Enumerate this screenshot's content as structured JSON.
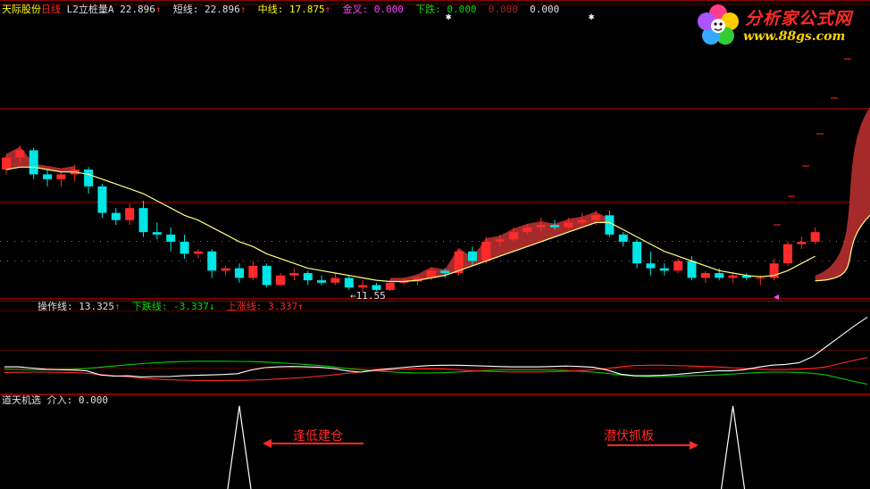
{
  "header": {
    "stock_name": "天际股份",
    "period": "日线",
    "indicator": "L2立桩量A",
    "value1": "22.896",
    "short_label": "短线:",
    "short_value": "22.896",
    "mid_label": "中线:",
    "mid_value": "17.875",
    "gold_label": "金叉:",
    "gold_value": "0.000",
    "down_label": "下跌:",
    "down_value": "0.000",
    "extra1": "0.000",
    "extra2": "0.000",
    "arrow_up": "↑",
    "arrow_down": "↓"
  },
  "low_marker": "11.55",
  "sub1": {
    "op_label": "操作线:",
    "op_value": "13.325",
    "down_label": "下跌线:",
    "down_value": "-3.337",
    "up_label": "上涨线:",
    "up_value": "3.337"
  },
  "sub2": {
    "title": "道天机选",
    "enter_label": "介入:",
    "enter_value": "0.000"
  },
  "logo": {
    "title": "分析家公式网",
    "url": "www.88gs.com"
  },
  "annotations": {
    "left": "逢低建仓",
    "right": "潜伏抓板"
  },
  "colors": {
    "up": "#ff2a2a",
    "down": "#00e5e5",
    "band": "#a52a2a",
    "ma": "#ffff80",
    "grid": "#8b0000",
    "green": "#00cc00",
    "white": "#ffffff"
  },
  "chart_data": {
    "type": "candlestick",
    "candles": [
      [
        16.6,
        17.2,
        16.4,
        17.1
      ],
      [
        17.1,
        17.6,
        16.9,
        17.4
      ],
      [
        17.4,
        17.5,
        16.2,
        16.4
      ],
      [
        16.4,
        16.6,
        15.9,
        16.2
      ],
      [
        16.2,
        16.5,
        15.9,
        16.4
      ],
      [
        16.4,
        16.8,
        16.1,
        16.6
      ],
      [
        16.6,
        16.7,
        15.6,
        15.9
      ],
      [
        15.9,
        16.0,
        14.6,
        14.8
      ],
      [
        14.8,
        15.0,
        14.3,
        14.5
      ],
      [
        14.5,
        15.2,
        14.3,
        15.0
      ],
      [
        15.0,
        15.3,
        13.8,
        14.0
      ],
      [
        14.0,
        14.4,
        13.7,
        13.9
      ],
      [
        13.9,
        14.2,
        13.2,
        13.6
      ],
      [
        13.6,
        13.9,
        12.9,
        13.1
      ],
      [
        13.1,
        13.3,
        12.9,
        13.2
      ],
      [
        13.2,
        13.3,
        12.1,
        12.4
      ],
      [
        12.4,
        12.6,
        12.2,
        12.5
      ],
      [
        12.5,
        12.7,
        11.9,
        12.1
      ],
      [
        12.1,
        12.8,
        12.0,
        12.6
      ],
      [
        12.6,
        12.7,
        11.7,
        11.8
      ],
      [
        11.8,
        12.3,
        11.8,
        12.2
      ],
      [
        12.2,
        12.5,
        12.0,
        12.3
      ],
      [
        12.3,
        12.4,
        11.8,
        12.0
      ],
      [
        12.0,
        12.2,
        11.8,
        11.9
      ],
      [
        11.9,
        12.3,
        11.8,
        12.1
      ],
      [
        12.1,
        12.2,
        11.6,
        11.7
      ],
      [
        11.7,
        12.0,
        11.5,
        11.8
      ],
      [
        11.8,
        11.9,
        11.55,
        11.6
      ],
      [
        11.6,
        12.0,
        11.55,
        11.9
      ],
      [
        11.9,
        12.1,
        11.8,
        11.95
      ],
      [
        11.95,
        12.2,
        11.8,
        12.1
      ],
      [
        12.1,
        12.5,
        12.0,
        12.4
      ],
      [
        12.4,
        12.5,
        12.1,
        12.3
      ],
      [
        12.3,
        13.3,
        12.2,
        13.2
      ],
      [
        13.2,
        13.4,
        12.6,
        12.8
      ],
      [
        12.8,
        13.8,
        12.7,
        13.6
      ],
      [
        13.6,
        13.9,
        13.4,
        13.7
      ],
      [
        13.7,
        14.2,
        13.6,
        14.0
      ],
      [
        14.0,
        14.3,
        13.9,
        14.2
      ],
      [
        14.2,
        14.6,
        14.0,
        14.3
      ],
      [
        14.3,
        14.5,
        14.1,
        14.2
      ],
      [
        14.2,
        14.6,
        14.1,
        14.4
      ],
      [
        14.4,
        14.8,
        14.3,
        14.5
      ],
      [
        14.5,
        14.9,
        14.3,
        14.7
      ],
      [
        14.7,
        14.9,
        13.8,
        13.9
      ],
      [
        13.9,
        14.0,
        13.4,
        13.6
      ],
      [
        13.6,
        13.7,
        12.5,
        12.7
      ],
      [
        12.7,
        13.2,
        12.2,
        12.5
      ],
      [
        12.5,
        12.7,
        12.2,
        12.4
      ],
      [
        12.4,
        12.9,
        12.3,
        12.8
      ],
      [
        12.8,
        13.0,
        12.0,
        12.1
      ],
      [
        12.1,
        12.4,
        11.9,
        12.3
      ],
      [
        12.3,
        12.5,
        12.0,
        12.1
      ],
      [
        12.1,
        12.3,
        11.9,
        12.2
      ],
      [
        12.2,
        12.3,
        12.0,
        12.1
      ],
      [
        12.1,
        12.2,
        11.8,
        12.1
      ],
      [
        12.1,
        12.9,
        12.0,
        12.7
      ],
      [
        12.7,
        13.6,
        12.6,
        13.5
      ],
      [
        13.5,
        13.8,
        13.3,
        13.6
      ],
      [
        13.6,
        14.2,
        13.5,
        14.0
      ]
    ],
    "ma": [
      16.6,
      16.7,
      16.7,
      16.6,
      16.5,
      16.5,
      16.4,
      16.2,
      16.0,
      15.8,
      15.6,
      15.3,
      15.0,
      14.7,
      14.5,
      14.2,
      13.9,
      13.6,
      13.4,
      13.1,
      12.9,
      12.7,
      12.5,
      12.4,
      12.3,
      12.2,
      12.1,
      12.0,
      11.95,
      11.95,
      12.0,
      12.1,
      12.2,
      12.4,
      12.6,
      12.8,
      13.0,
      13.2,
      13.4,
      13.6,
      13.8,
      14.0,
      14.2,
      14.4,
      14.4,
      14.1,
      13.8,
      13.5,
      13.2,
      13.0,
      12.8,
      12.6,
      12.4,
      12.3,
      12.2,
      12.15,
      12.2,
      12.4,
      12.7,
      13.0
    ],
    "band_extension": {
      "start": 12.2,
      "end_upper": 19.2,
      "end_lower": 14.7
    },
    "y_range": [
      11.3,
      22.9
    ],
    "sub1_series": {
      "op_line": [
        1.0,
        1.0,
        0.7,
        0.4,
        0.3,
        0.2,
        0.0,
        -1.0,
        -1.3,
        -1.2,
        -1.5,
        -1.4,
        -1.4,
        -1.2,
        -1.1,
        -1.0,
        -0.9,
        -0.7,
        0.2,
        0.8,
        1.0,
        1.1,
        1.0,
        0.9,
        0.6,
        0.0,
        -0.3,
        0.2,
        0.5,
        0.8,
        1.1,
        1.3,
        1.4,
        1.4,
        1.3,
        1.2,
        1.1,
        1.0,
        1.0,
        1.0,
        1.1,
        1.2,
        1.1,
        0.9,
        0.2,
        -0.8,
        -1.2,
        -1.2,
        -1.1,
        -0.9,
        -0.6,
        -0.3,
        0.0,
        0.0,
        0.3,
        0.9,
        1.4,
        1.6,
        2.0,
        3.5,
        6.0,
        8.5,
        11.0,
        13.3
      ],
      "down_line": [
        0.4,
        0.35,
        0.3,
        0.3,
        0.35,
        0.4,
        0.6,
        0.9,
        1.2,
        1.5,
        1.8,
        2.0,
        2.2,
        2.3,
        2.4,
        2.4,
        2.4,
        2.35,
        2.3,
        2.2,
        2.0,
        1.8,
        1.6,
        1.3,
        1.0,
        0.6,
        0.3,
        0.0,
        -0.2,
        -0.4,
        -0.5,
        -0.5,
        -0.45,
        -0.3,
        -0.1,
        0.1,
        0.2,
        0.25,
        0.25,
        0.25,
        0.2,
        0.1,
        -0.1,
        -0.3,
        -0.6,
        -1.0,
        -1.3,
        -1.4,
        -1.4,
        -1.3,
        -1.2,
        -1.1,
        -1.0,
        -0.8,
        -0.6,
        -0.4,
        -0.3,
        -0.3,
        -0.4,
        -0.6,
        -1.0,
        -1.8,
        -2.6,
        -3.3
      ],
      "up_line": [
        -0.4,
        -0.35,
        -0.3,
        -0.3,
        -0.35,
        -0.4,
        -0.6,
        -0.9,
        -1.2,
        -1.5,
        -1.8,
        -2.0,
        -2.2,
        -2.3,
        -2.4,
        -2.4,
        -2.4,
        -2.35,
        -2.3,
        -2.2,
        -2.0,
        -1.8,
        -1.6,
        -1.3,
        -1.0,
        -0.6,
        -0.3,
        0.0,
        0.2,
        0.4,
        0.5,
        0.5,
        0.45,
        0.3,
        0.1,
        -0.1,
        -0.2,
        -0.25,
        -0.25,
        -0.25,
        -0.2,
        -0.1,
        0.1,
        0.3,
        0.6,
        1.0,
        1.3,
        1.4,
        1.4,
        1.3,
        1.2,
        1.1,
        1.0,
        0.8,
        0.6,
        0.4,
        0.3,
        0.3,
        0.4,
        0.6,
        1.0,
        1.8,
        2.6,
        3.3
      ],
      "y_range": [
        -4.5,
        14.5
      ]
    },
    "sub2_signals": [
      {
        "bar": 17,
        "label": "left"
      },
      {
        "bar": 53,
        "label": "right"
      }
    ]
  }
}
